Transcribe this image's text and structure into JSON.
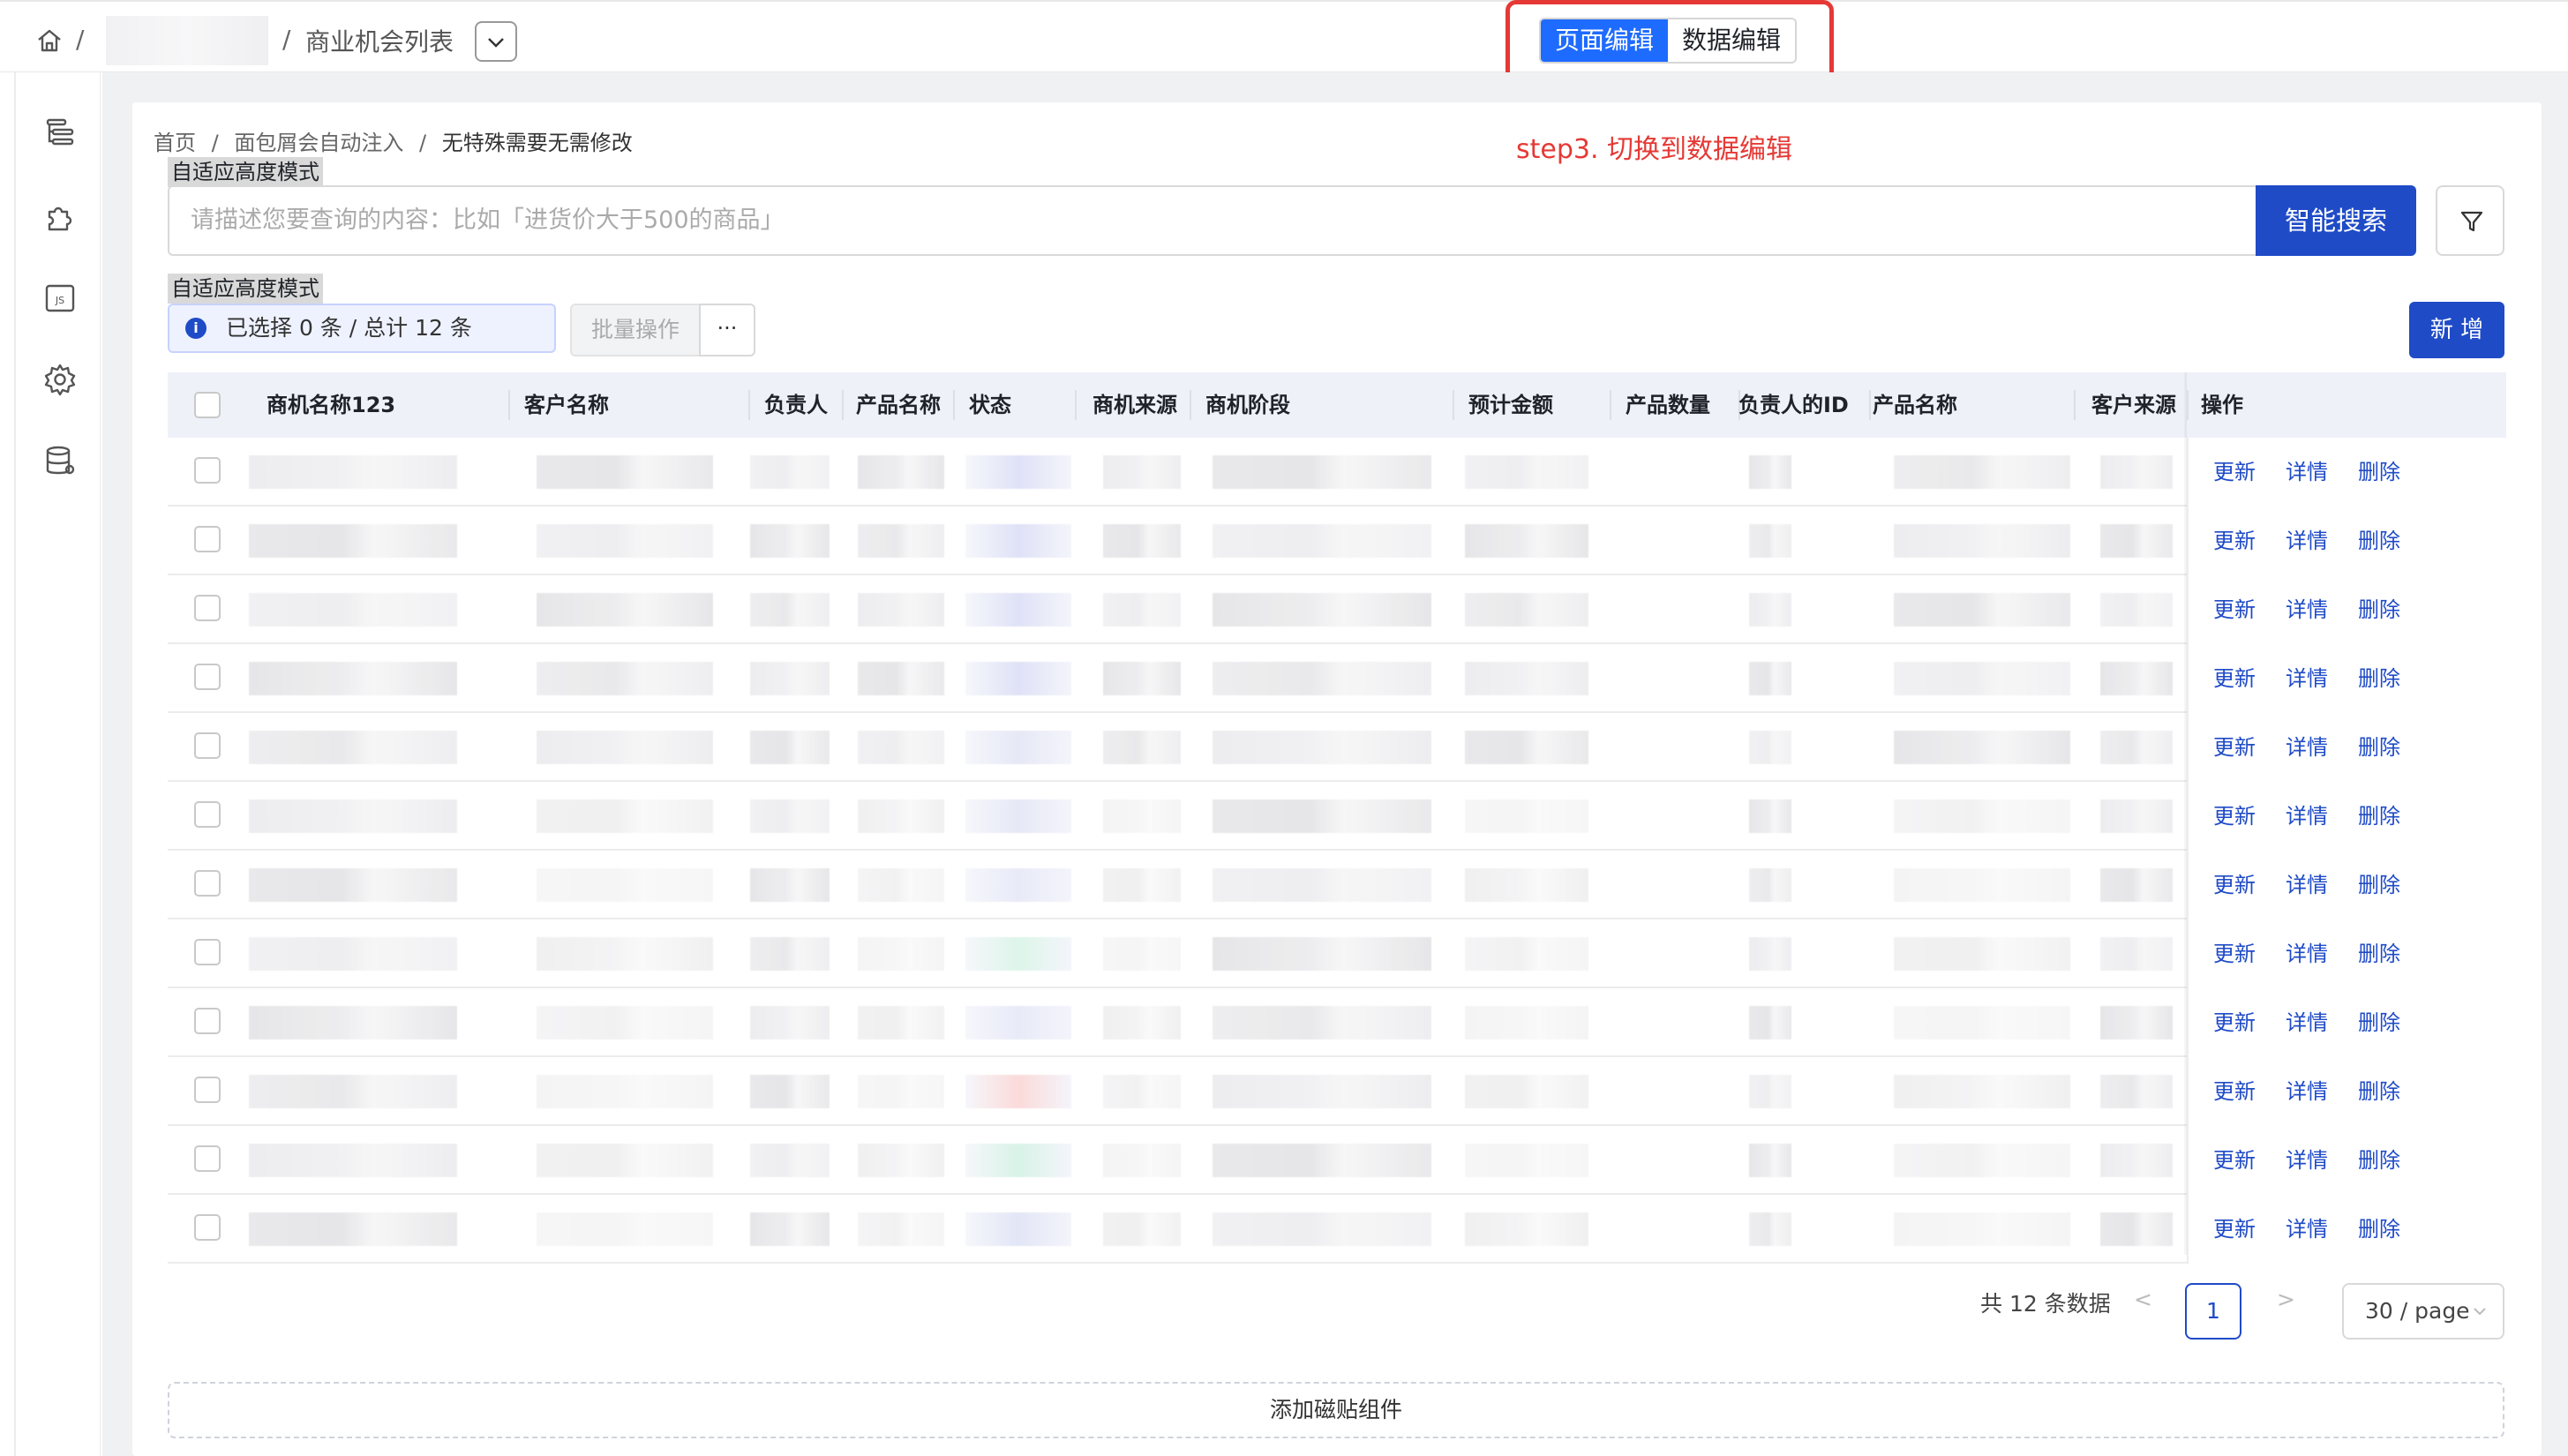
{
  "topbar": {
    "sep": "/",
    "breadcrumb_title": "商业机会列表",
    "mode_toggle": {
      "page_edit": "页面编辑",
      "data_edit": "数据编辑",
      "active": "page_edit"
    }
  },
  "annotation": {
    "text": "step3. 切换到数据编辑",
    "color": "#e53935"
  },
  "sidebar": {
    "icons": [
      "outline-icon",
      "plugin-icon",
      "js-icon",
      "gear-icon",
      "database-icon"
    ]
  },
  "page_breadcrumb": {
    "items": [
      "首页",
      "面包屑会自动注入",
      "无特殊需要无需修改"
    ],
    "sep": "/"
  },
  "adaptive_label": "自适应高度模式",
  "search": {
    "placeholder": "请描述您要查询的内容：比如「进货价大于500的商品」",
    "button": "智能搜索"
  },
  "toolbar": {
    "selection_info": "已选择 0 条 / 总计 12 条",
    "batch_label": "批量操作",
    "more_label": "···",
    "add_label": "新 增"
  },
  "table": {
    "columns": [
      "商机名称123",
      "客户名称",
      "负责人",
      "产品名称",
      "状态",
      "商机来源",
      "商机阶段",
      "预计金额",
      "产品数量",
      "负责人的ID",
      "产品名称",
      "客户来源",
      "操作"
    ],
    "row_actions": [
      "更新",
      "详情",
      "删除"
    ],
    "row_count": 12
  },
  "pagination": {
    "total_text": "共 12 条数据",
    "prev": "<",
    "next": ">",
    "current_page": "1",
    "page_size": "30 / page"
  },
  "add_component": "添加磁贴组件",
  "colors": {
    "primary": "#1f4bc7",
    "toggle_active": "#1e6bff",
    "highlight": "#e53935"
  }
}
